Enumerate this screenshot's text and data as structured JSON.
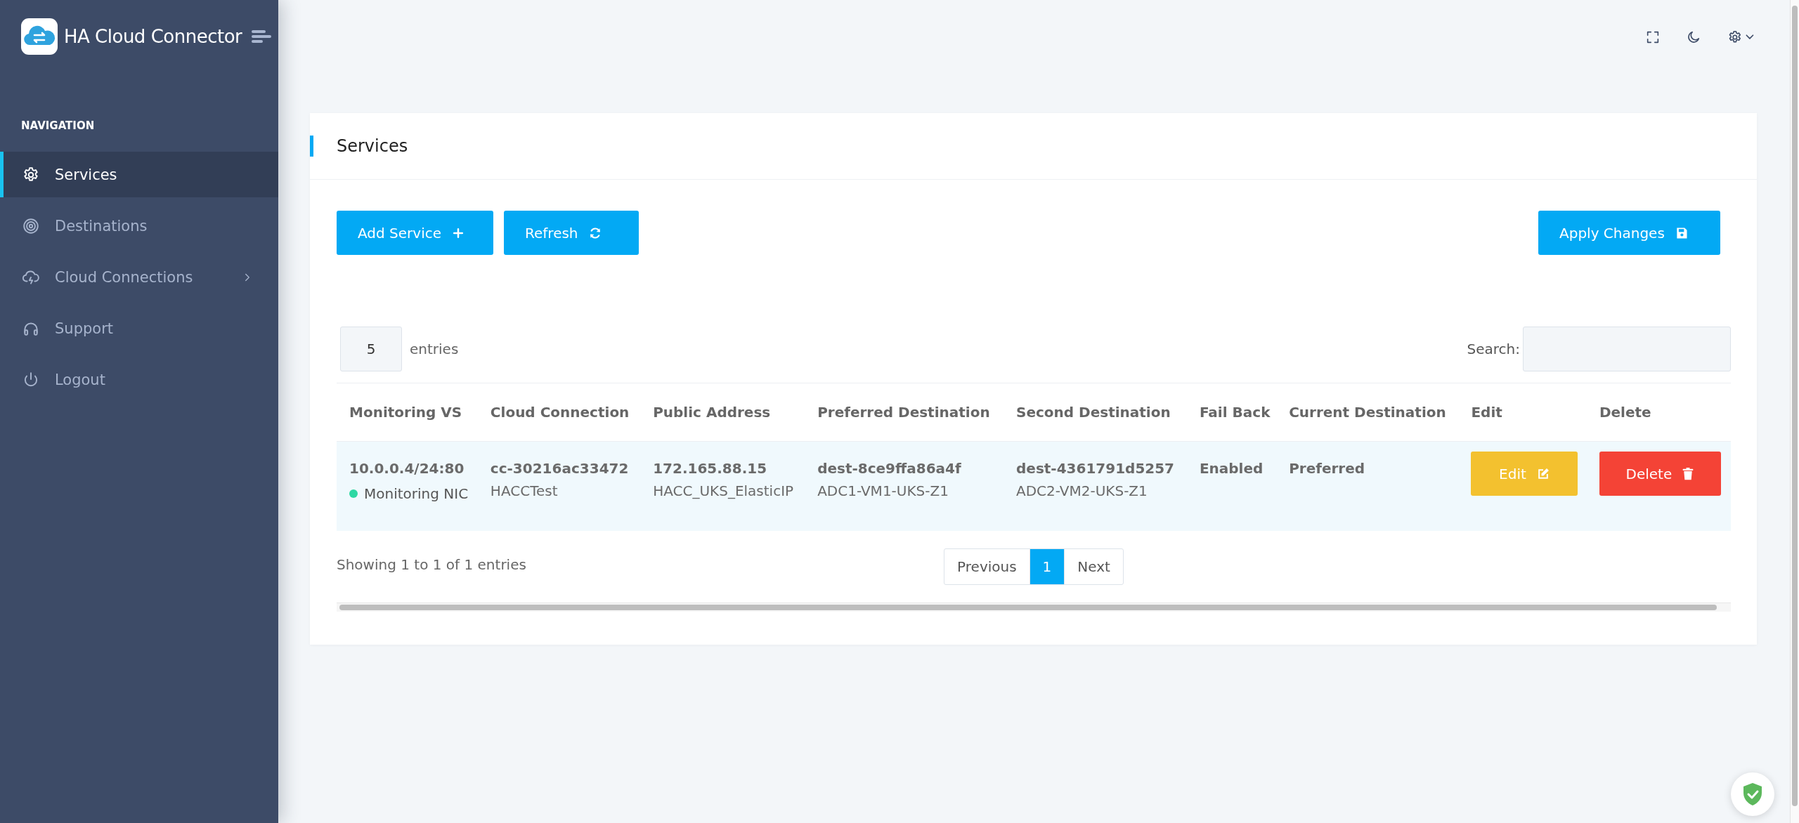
{
  "sidebar": {
    "brand": "HA Cloud Connector",
    "section_label": "NAVIGATION",
    "items": [
      {
        "label": "Services",
        "selected": true
      },
      {
        "label": "Destinations",
        "selected": false
      },
      {
        "label": "Cloud Connections",
        "selected": false,
        "expanded": false
      },
      {
        "label": "Support",
        "selected": false
      },
      {
        "label": "Logout",
        "selected": false
      }
    ]
  },
  "card": {
    "title": "Services",
    "buttons": [
      {
        "label": "Add Service",
        "kind": "add"
      },
      {
        "label": "Refresh",
        "kind": "refresh"
      },
      {
        "label": "Apply Changes",
        "kind": "apply"
      }
    ],
    "length": {
      "value": "5",
      "label": "entries"
    },
    "search": {
      "label": "Search:"
    },
    "table": {
      "columns": [
        "Monitoring VS",
        "Cloud Connection",
        "Public Address",
        "Preferred Destination",
        "Second Destination",
        "Fail Back",
        "Current Destination",
        "Edit",
        "Delete"
      ],
      "rows": [
        {
          "cells": [
            {
              "kind": "status",
              "primary": "10.0.0.4/24:80",
              "status": {
                "label": "Monitoring NIC",
                "color": "#2ed8a3"
              }
            },
            {
              "kind": "stacked",
              "primary": "cc-30216ac33472",
              "secondary": "HACCTest"
            },
            {
              "kind": "stacked",
              "primary": "172.165.88.15",
              "secondary": "HACC_UKS_ElasticIP"
            },
            {
              "kind": "stacked",
              "primary": "dest-8ce9ffa86a4f",
              "secondary": "ADC1-VM1-UKS-Z1"
            },
            {
              "kind": "stacked",
              "primary": "dest-4361791d5257",
              "secondary": "ADC2-VM2-UKS-Z1"
            },
            {
              "kind": "plain",
              "primary": "Enabled"
            },
            {
              "kind": "plain",
              "primary": "Preferred"
            },
            {
              "kind": "edit",
              "label": "Edit"
            },
            {
              "kind": "delete",
              "label": "Delete"
            }
          ]
        }
      ]
    },
    "info": "Showing 1 to 1 of 1 entries",
    "pagination": [
      {
        "label": "Previous",
        "selected": false
      },
      {
        "label": "1",
        "selected": true
      },
      {
        "label": "Next",
        "selected": false
      }
    ]
  }
}
